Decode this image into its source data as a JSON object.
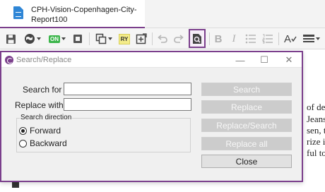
{
  "document": {
    "tab_title": "CPH-Vision-Copenhagen-City-Report100",
    "tab_icon": "document-icon",
    "background_lines": [
      "of des",
      "Jeans,",
      "sen, to",
      "rize is",
      "ful tov"
    ]
  },
  "toolbar": {
    "on_badge": "ON",
    "ry_badge": "RY",
    "bold": "B",
    "italic": "I",
    "spell": "A",
    "icons": [
      "save-icon",
      "globe-icon",
      "on-badge-icon",
      "record-icon",
      "copy-icon",
      "ry-badge-icon",
      "insert-icon",
      "undo-icon",
      "redo-icon",
      "search-replace-icon",
      "bold-icon",
      "italic-icon",
      "bullet-list-icon",
      "numbered-list-icon",
      "spellcheck-icon",
      "align-icon"
    ]
  },
  "dialog": {
    "title": "Search/Replace",
    "minimize_symbol": "—",
    "maximize_symbol": "☐",
    "close_symbol": "✕",
    "search_label": "Search for",
    "search_value": "",
    "replace_label": "Replace with",
    "replace_value": "",
    "direction_group": "Search direction",
    "radio_forward": "Forward",
    "radio_backward": "Backward",
    "selected_direction": "Forward",
    "buttons": {
      "search": "Search",
      "replace": "Replace",
      "replace_search": "Replace/Search",
      "replace_all": "Replace all",
      "close": "Close"
    }
  },
  "colors": {
    "accent": "#7b3f8c",
    "dialog_bg": "#f0f0f0",
    "disabled_button": "#cccccc",
    "enabled_button": "#e1e1e1"
  }
}
